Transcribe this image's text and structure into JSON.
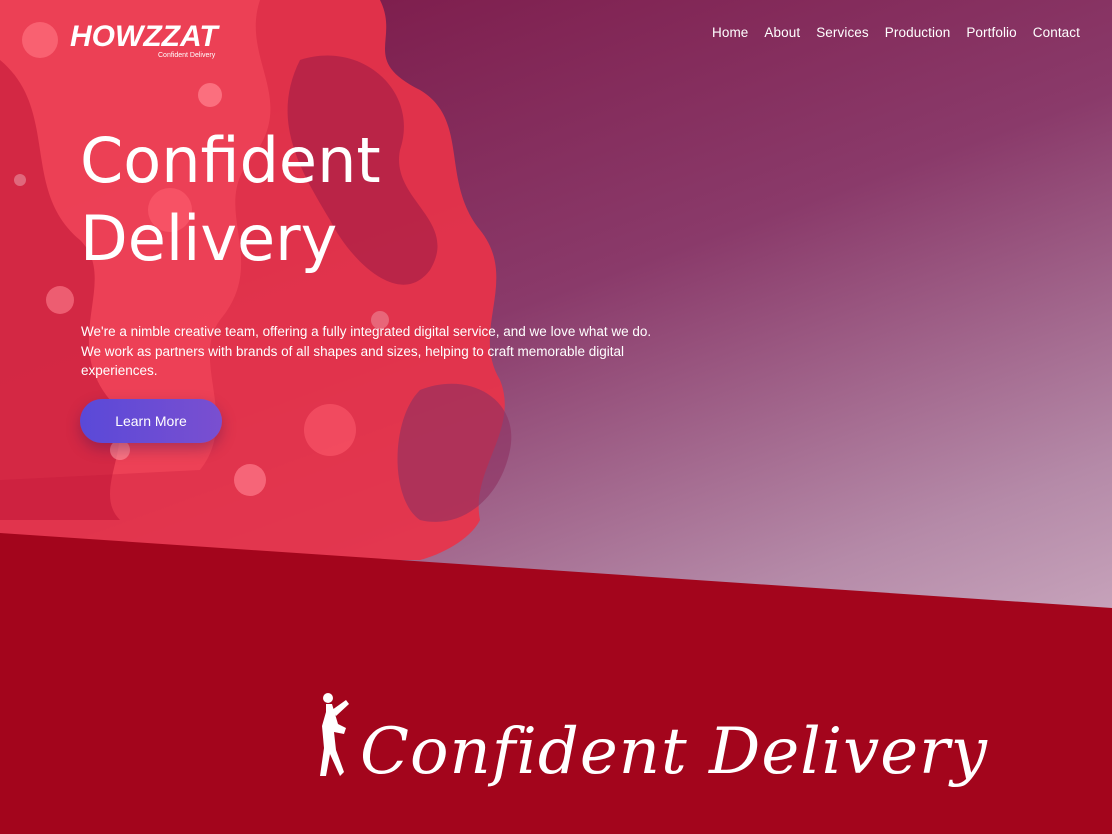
{
  "brand": {
    "logo_text": "HOWZZAT",
    "logo_tagline": "Confident Delivery"
  },
  "nav": {
    "items": [
      "Home",
      "About",
      "Services",
      "Production",
      "Portfolio",
      "Contact"
    ]
  },
  "hero": {
    "headline_line1": "Confident",
    "headline_line2": "Delivery",
    "intro": "We're a nimble creative team, offering a fully integrated digital service, and we love what we do. We work as partners with brands of all shapes and sizes, helping to craft memorable digital experiences.",
    "cta_label": "Learn More"
  },
  "banner": {
    "script_title": "Confident Delivery"
  },
  "colors": {
    "band_red": "#a3051c",
    "splash_red": "#e8334a",
    "cta_purple": "#5a49d8"
  }
}
